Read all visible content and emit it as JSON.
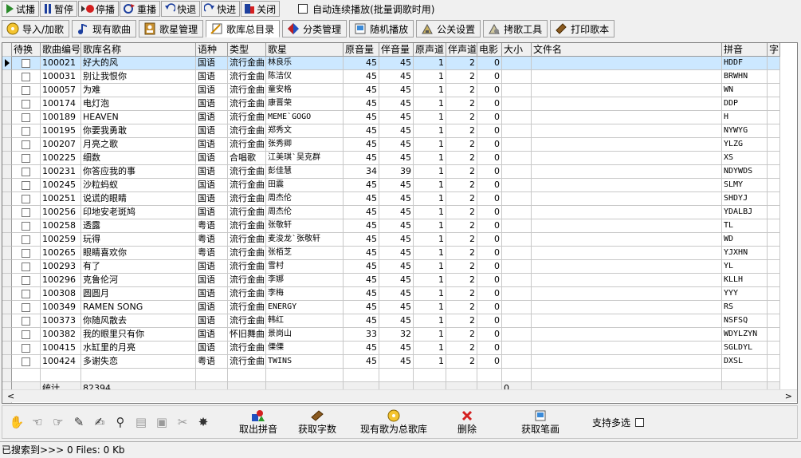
{
  "toolbar": {
    "buttons": [
      {
        "label": "试播",
        "icon": "play-icon"
      },
      {
        "label": "暂停",
        "icon": "pause-icon"
      },
      {
        "label": "停播",
        "icon": "stop-icon"
      },
      {
        "label": "重播",
        "icon": "replay-icon"
      },
      {
        "label": "快退",
        "icon": "rewind-icon"
      },
      {
        "label": "快进",
        "icon": "forward-icon"
      },
      {
        "label": "关闭",
        "icon": "close-icon"
      }
    ],
    "autoplay_label": "自动连续播放(批量调歌时用)"
  },
  "tabs": [
    {
      "label": "导入/加歌",
      "icon": "disc-icon"
    },
    {
      "label": "现有歌曲",
      "icon": "music-note-icon"
    },
    {
      "label": "歌星管理",
      "icon": "portrait-icon"
    },
    {
      "label": "歌库总目录",
      "icon": "catalog-icon",
      "active": true
    },
    {
      "label": "分类管理",
      "icon": "category-icon"
    },
    {
      "label": "随机播放",
      "icon": "random-icon"
    },
    {
      "label": "公关设置",
      "icon": "settings-icon"
    },
    {
      "label": "拷歌工具",
      "icon": "copy-tool-icon"
    },
    {
      "label": "打印歌本",
      "icon": "print-book-icon"
    }
  ],
  "table": {
    "headers": [
      "待换",
      "歌曲编号",
      "歌库名称",
      "语种",
      "类型",
      "歌星",
      "原音量",
      "伴音量",
      "原声道",
      "伴声道",
      "电影",
      "大小",
      "文件名",
      "拼音",
      "字"
    ],
    "rows": [
      [
        "100021",
        "好大的风",
        "国语",
        "流行金曲",
        "林良乐",
        "45",
        "45",
        "1",
        "2",
        "0",
        "HDDF"
      ],
      [
        "100031",
        "别让我恨你",
        "国语",
        "流行金曲",
        "陈洁仪",
        "45",
        "45",
        "1",
        "2",
        "0",
        "BRWHN"
      ],
      [
        "100057",
        "为难",
        "国语",
        "流行金曲",
        "童安格",
        "45",
        "45",
        "1",
        "2",
        "0",
        "WN"
      ],
      [
        "100174",
        "电灯泡",
        "国语",
        "流行金曲",
        "康晋荣",
        "45",
        "45",
        "1",
        "2",
        "0",
        "DDP"
      ],
      [
        "100189",
        "HEAVEN",
        "国语",
        "流行金曲",
        "MEME`GOGO",
        "45",
        "45",
        "1",
        "2",
        "0",
        "H"
      ],
      [
        "100195",
        "你要我勇敢",
        "国语",
        "流行金曲",
        "郑秀文",
        "45",
        "45",
        "1",
        "2",
        "0",
        "NYWYG"
      ],
      [
        "100207",
        "月亮之歌",
        "国语",
        "流行金曲",
        "张秀卿",
        "45",
        "45",
        "1",
        "2",
        "0",
        "YLZG"
      ],
      [
        "100225",
        "细数",
        "国语",
        "合唱歌",
        "江美琪`吴克群",
        "45",
        "45",
        "1",
        "2",
        "0",
        "XS"
      ],
      [
        "100231",
        "你答应我的事",
        "国语",
        "流行金曲",
        "彭佳慧",
        "34",
        "39",
        "1",
        "2",
        "0",
        "NDYWDS"
      ],
      [
        "100245",
        "沙粒蚂蚁",
        "国语",
        "流行金曲",
        "田震",
        "45",
        "45",
        "1",
        "2",
        "0",
        "SLMY"
      ],
      [
        "100251",
        "说谎的眼睛",
        "国语",
        "流行金曲",
        "周杰伦",
        "45",
        "45",
        "1",
        "2",
        "0",
        "SHDYJ"
      ],
      [
        "100256",
        "印地安老斑鸠",
        "国语",
        "流行金曲",
        "周杰伦",
        "45",
        "45",
        "1",
        "2",
        "0",
        "YDALBJ"
      ],
      [
        "100258",
        "透露",
        "粤语",
        "流行金曲",
        "张敬轩",
        "45",
        "45",
        "1",
        "2",
        "0",
        "TL"
      ],
      [
        "100259",
        "玩得",
        "粤语",
        "流行金曲",
        "麦浚龙`张敬轩",
        "45",
        "45",
        "1",
        "2",
        "0",
        "WD"
      ],
      [
        "100265",
        "眼睛喜欢你",
        "粤语",
        "流行金曲",
        "张栢芝",
        "45",
        "45",
        "1",
        "2",
        "0",
        "YJXHN"
      ],
      [
        "100293",
        "有了",
        "国语",
        "流行金曲",
        "雪村",
        "45",
        "45",
        "1",
        "2",
        "0",
        "YL"
      ],
      [
        "100296",
        "克鲁伦河",
        "国语",
        "流行金曲",
        "李娜",
        "45",
        "45",
        "1",
        "2",
        "0",
        "KLLH"
      ],
      [
        "100308",
        "圆圆月",
        "国语",
        "流行金曲",
        "李梅",
        "45",
        "45",
        "1",
        "2",
        "0",
        "YYY"
      ],
      [
        "100349",
        "RAMEN SONG",
        "国语",
        "流行金曲",
        "ENERGY",
        "45",
        "45",
        "1",
        "2",
        "0",
        "RS"
      ],
      [
        "100373",
        "你随风散去",
        "国语",
        "流行金曲",
        "韩红",
        "45",
        "45",
        "1",
        "2",
        "0",
        "NSFSQ"
      ],
      [
        "100382",
        "我的眼里只有你",
        "国语",
        "怀旧舞曲",
        "景岗山",
        "33",
        "32",
        "1",
        "2",
        "0",
        "WDYLZYN"
      ],
      [
        "100415",
        "水缸里的月亮",
        "国语",
        "流行金曲",
        "傈傈",
        "45",
        "45",
        "1",
        "2",
        "0",
        "SGLDYL"
      ],
      [
        "100424",
        "多谢失恋",
        "粤语",
        "流行金曲",
        "TWINS",
        "45",
        "45",
        "1",
        "2",
        "0",
        "DXSL"
      ]
    ],
    "footer": {
      "label": "统计",
      "count": "82394",
      "size": "0"
    }
  },
  "bottom_icons": [
    "hand-icon",
    "pointer-hand-icon",
    "thumb-hand-icon",
    "pen-icon",
    "document-edit-icon",
    "search-page-icon",
    "notepad-icon",
    "save-icon",
    "cut-icon",
    "sparkle-icon"
  ],
  "actions": [
    {
      "label": "取出拼音",
      "icon": "shapes-icon"
    },
    {
      "label": "获取字数",
      "icon": "book-icon"
    },
    {
      "label": "现有歌为总歌库",
      "icon": "cd-icon"
    },
    {
      "label": "删除",
      "icon": "delete-x-icon"
    },
    {
      "label": "获取笔画",
      "icon": "image-edit-icon"
    }
  ],
  "multi_select_label": "支持多选",
  "status": "已搜索到>>> 0 Files: 0 Kb",
  "colors": {
    "selected_row": "#cce8ff",
    "background": "#f0f0f0"
  }
}
